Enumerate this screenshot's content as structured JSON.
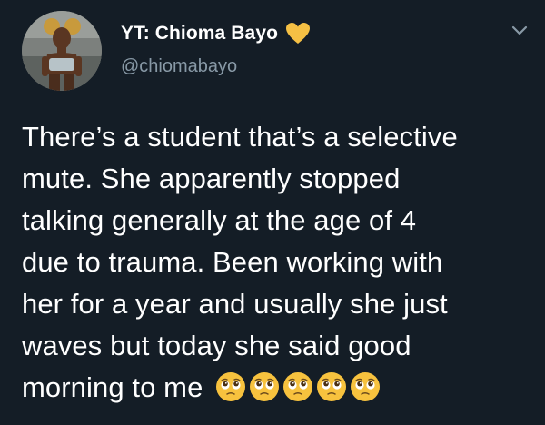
{
  "author": {
    "display_name": "YT: Chioma Bayo",
    "handle": "@chiomabayo",
    "verified_badge_icon": "yellow-heart-icon",
    "badge_color": "#f5c044"
  },
  "tweet": {
    "text_lines": [
      "There’s a student that’s a selective",
      "mute. She apparently stopped",
      "talking generally at the age of 4",
      "due to trauma. Been working with",
      "her for a year and usually she just",
      "waves but today she said good",
      "morning to me"
    ],
    "trailing_emojis": [
      "pleading-face-icon",
      "pleading-face-icon",
      "pleading-face-icon",
      "pleading-face-icon",
      "pleading-face-icon"
    ]
  },
  "menu": {
    "icon": "chevron-down-icon"
  },
  "colors": {
    "background": "#141d26",
    "primary_text": "#ffffff",
    "secondary_text": "#8899a6",
    "emoji_yellow": "#f7c23e"
  }
}
